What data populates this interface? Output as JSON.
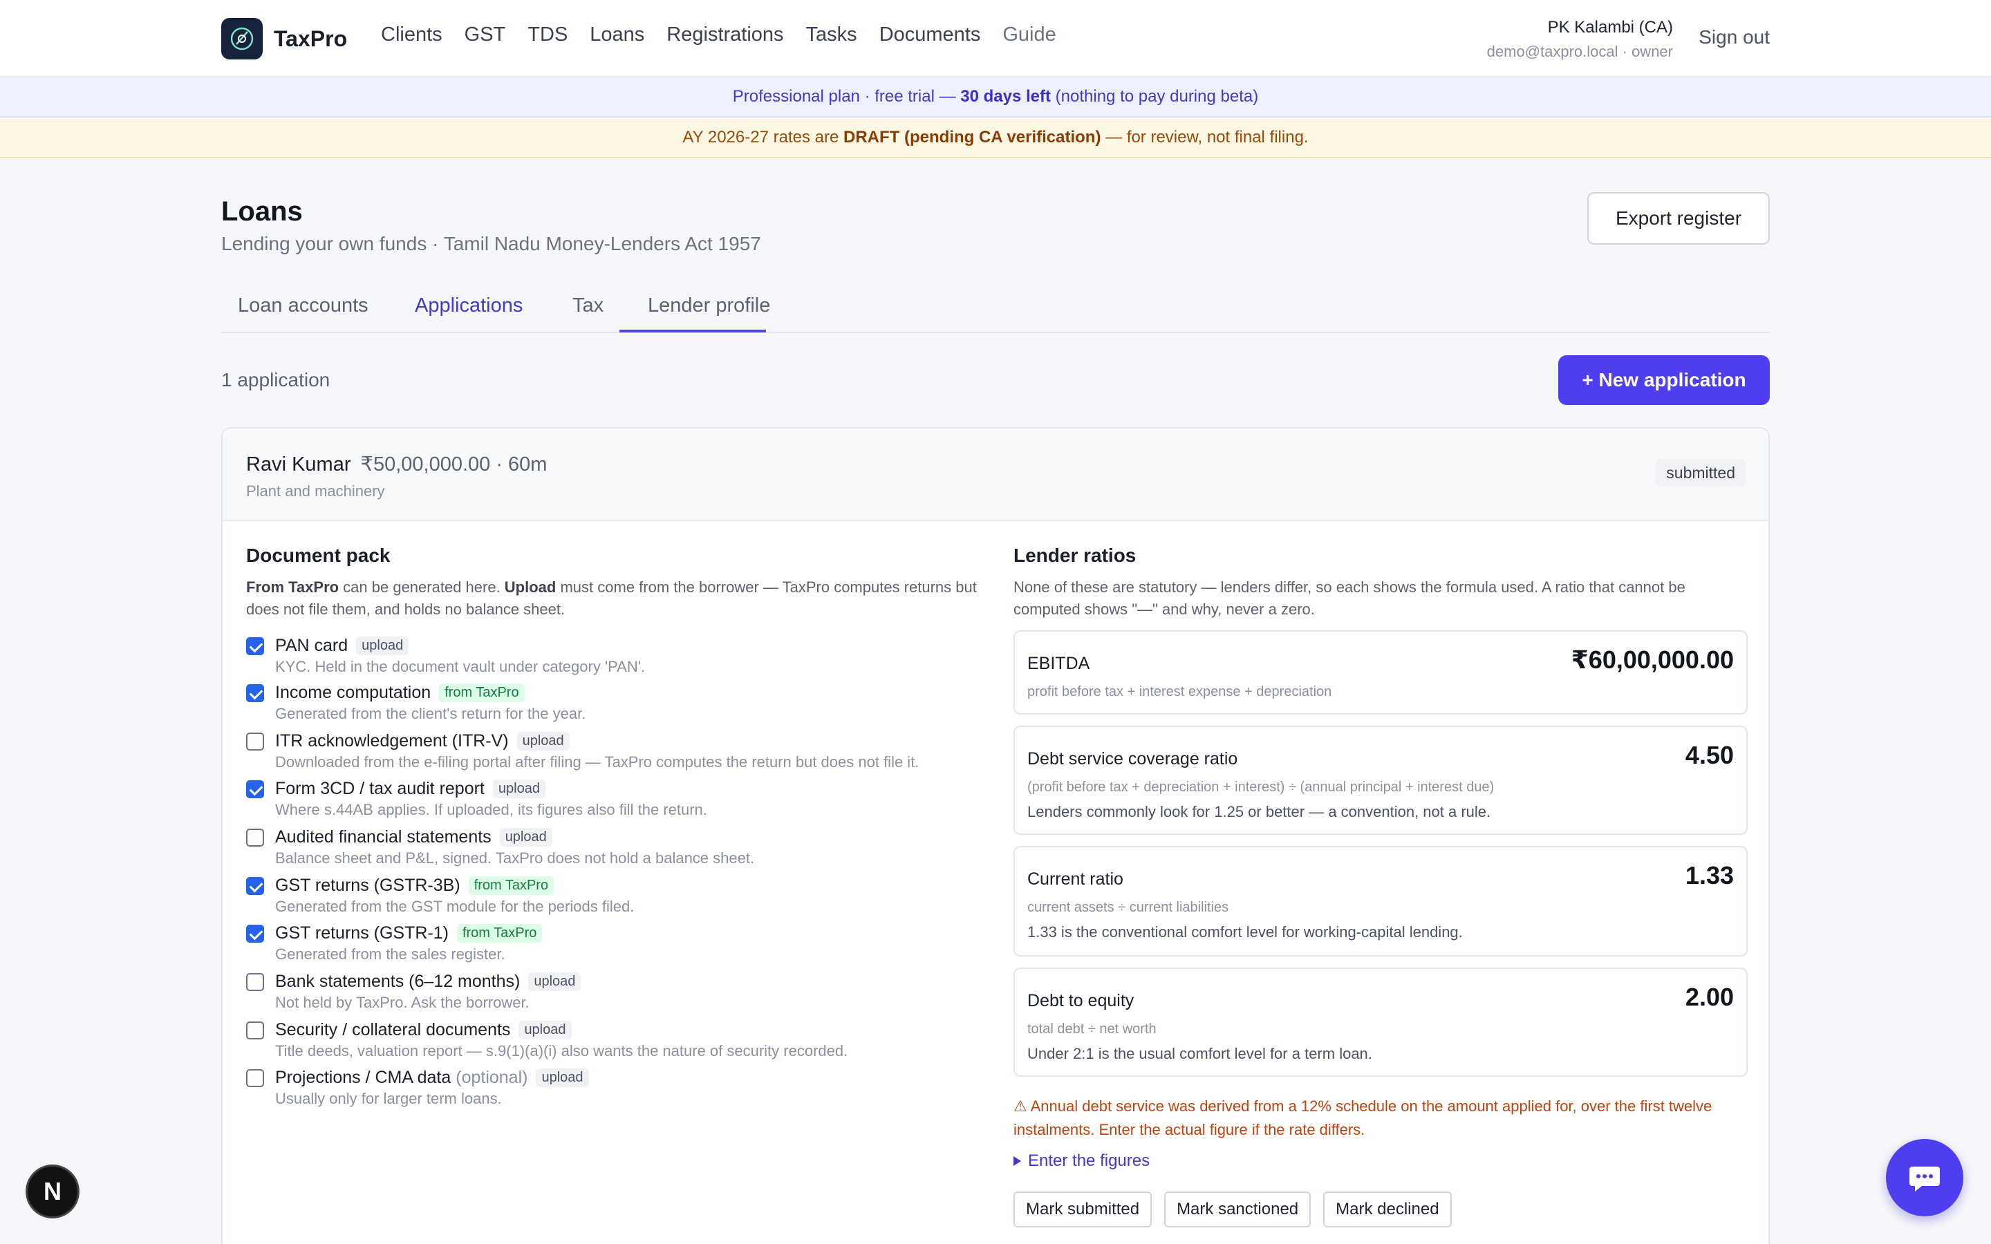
{
  "app": {
    "name": "TaxPro"
  },
  "nav": {
    "links": [
      "Clients",
      "GST",
      "TDS",
      "Loans",
      "Registrations",
      "Tasks",
      "Documents",
      "Guide"
    ]
  },
  "user": {
    "name": "PK Kalambi (CA)",
    "email_role": "demo@taxpro.local · owner",
    "signout_label": "Sign out"
  },
  "banners": {
    "plan_prefix": "Professional plan · free trial — ",
    "plan_bold": "30 days left",
    "plan_suffix": " (nothing to pay during beta)",
    "draft_prefix": "AY 2026-27 rates are ",
    "draft_bold": "DRAFT (pending CA verification)",
    "draft_suffix": " — for review, not final filing."
  },
  "page": {
    "title": "Loans",
    "subtitle": "Lending your own funds · Tamil Nadu Money-Lenders Act 1957",
    "export_label": "Export register"
  },
  "tabs": [
    "Loan accounts",
    "Applications",
    "Tax",
    "Lender profile"
  ],
  "applications": {
    "count_label": "1 application",
    "new_label": "+ New application"
  },
  "application": {
    "borrower": "Ravi Kumar",
    "amount_term": "₹50,00,000.00 · 60m",
    "purpose": "Plant and machinery",
    "status": "submitted"
  },
  "document_pack": {
    "title": "Document pack",
    "desc_b1": "From TaxPro",
    "desc_t1": " can be generated here. ",
    "desc_b2": "Upload",
    "desc_t2": " must come from the borrower — TaxPro computes returns but does not file them, and holds no balance sheet.",
    "items": [
      {
        "label": "PAN card",
        "optional": "",
        "tag": "upload",
        "checked": true,
        "note": "KYC. Held in the document vault under category 'PAN'."
      },
      {
        "label": "Income computation",
        "optional": "",
        "tag": "from TaxPro",
        "checked": true,
        "note": "Generated from the client's return for the year."
      },
      {
        "label": "ITR acknowledgement (ITR-V)",
        "optional": "",
        "tag": "upload",
        "checked": false,
        "note": "Downloaded from the e-filing portal after filing — TaxPro computes the return but does not file it."
      },
      {
        "label": "Form 3CD / tax audit report",
        "optional": "",
        "tag": "upload",
        "checked": true,
        "note": "Where s.44AB applies. If uploaded, its figures also fill the return."
      },
      {
        "label": "Audited financial statements",
        "optional": "",
        "tag": "upload",
        "checked": false,
        "note": "Balance sheet and P&L, signed. TaxPro does not hold a balance sheet."
      },
      {
        "label": "GST returns (GSTR-3B)",
        "optional": "",
        "tag": "from TaxPro",
        "checked": true,
        "note": "Generated from the GST module for the periods filed."
      },
      {
        "label": "GST returns (GSTR-1)",
        "optional": "",
        "tag": "from TaxPro",
        "checked": true,
        "note": "Generated from the sales register."
      },
      {
        "label": "Bank statements (6–12 months)",
        "optional": "",
        "tag": "upload",
        "checked": false,
        "note": "Not held by TaxPro. Ask the borrower."
      },
      {
        "label": "Security / collateral documents",
        "optional": "",
        "tag": "upload",
        "checked": false,
        "note": "Title deeds, valuation report — s.9(1)(a)(i) also wants the nature of security recorded."
      },
      {
        "label": "Projections / CMA data",
        "optional": " (optional)",
        "tag": "upload",
        "checked": false,
        "note": "Usually only for larger term loans."
      }
    ]
  },
  "lender_ratios": {
    "title": "Lender ratios",
    "desc": "None of these are statutory — lenders differ, so each shows the formula used. A ratio that cannot be computed shows \"—\" and why, never a zero.",
    "ratios": [
      {
        "name": "EBITDA",
        "value": "₹60,00,000.00",
        "formula": "profit before tax + interest expense + depreciation",
        "note": ""
      },
      {
        "name": "Debt service coverage ratio",
        "value": "4.50",
        "formula": "(profit before tax + depreciation + interest) ÷ (annual principal + interest due)",
        "note": "Lenders commonly look for 1.25 or better — a convention, not a rule."
      },
      {
        "name": "Current ratio",
        "value": "1.33",
        "formula": "current assets ÷ current liabilities",
        "note": "1.33 is the conventional comfort level for working-capital lending."
      },
      {
        "name": "Debt to equity",
        "value": "2.00",
        "formula": "total debt ÷ net worth",
        "note": "Under 2:1 is the usual comfort level for a term loan."
      }
    ],
    "warning": "⚠ Annual debt service was derived from a 12% schedule on the amount applied for, over the first twelve instalments. Enter the actual figure if the rate differs.",
    "enter_figures": "Enter the figures",
    "actions": [
      "Mark submitted",
      "Mark sanctioned",
      "Mark declined"
    ]
  },
  "widgets": {
    "next_letter": "N"
  },
  "colors": {
    "accent": "#4f3ef0",
    "checkbox": "#2563eb",
    "warning": "#c2410c"
  }
}
